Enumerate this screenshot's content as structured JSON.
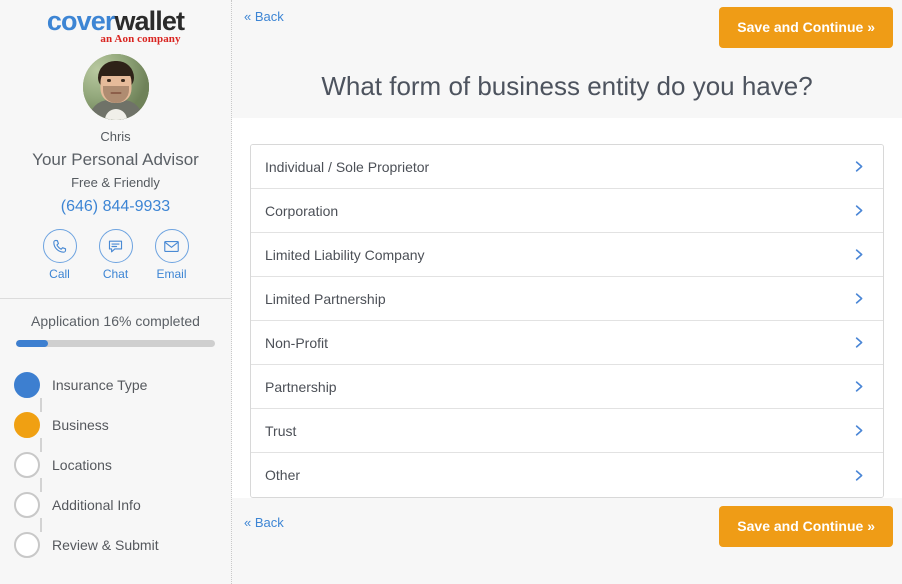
{
  "brand": {
    "logo_part1": "cover",
    "logo_part2": "wallet",
    "tagline": "an Aon company"
  },
  "sidebar": {
    "advisor": {
      "name": "Chris",
      "role": "Your Personal Advisor",
      "tagline": "Free & Friendly",
      "phone": "(646) 844-9933",
      "avatar_alt": "advisor-photo"
    },
    "contacts": [
      {
        "label": "Call",
        "icon": "phone-icon"
      },
      {
        "label": "Chat",
        "icon": "chat-icon"
      },
      {
        "label": "Email",
        "icon": "envelope-icon"
      }
    ],
    "progress": {
      "text": "Application 16% completed",
      "percent": 16,
      "fill_color": "#3d7fd0",
      "track_color": "#cfcfcf"
    },
    "steps": [
      {
        "label": "Insurance Type",
        "state": "done",
        "color": "#3d7fd0"
      },
      {
        "label": "Business",
        "state": "active",
        "color": "#f0a012"
      },
      {
        "label": "Locations",
        "state": "pending",
        "color": "#ffffff"
      },
      {
        "label": "Additional Info",
        "state": "pending",
        "color": "#ffffff"
      },
      {
        "label": "Review & Submit",
        "state": "pending",
        "color": "#ffffff"
      }
    ]
  },
  "main": {
    "top_back_label": "« Back",
    "top_save_label": "Save and Continue »",
    "title": "What form of business entity do you have?",
    "bottom_back_label": "« Back",
    "bottom_save_label": "Save and Continue »",
    "options": [
      {
        "label": "Individual / Sole Proprietor",
        "icon": "chevron-right-icon"
      },
      {
        "label": "Corporation",
        "icon": "chevron-right-icon"
      },
      {
        "label": "Limited Liability Company",
        "icon": "chevron-right-icon"
      },
      {
        "label": "Limited Partnership",
        "icon": "chevron-right-icon"
      },
      {
        "label": "Non-Profit",
        "icon": "chevron-right-icon"
      },
      {
        "label": "Partnership",
        "icon": "chevron-right-icon"
      },
      {
        "label": "Trust",
        "icon": "chevron-right-icon"
      },
      {
        "label": "Other",
        "icon": "chevron-right-icon"
      }
    ]
  },
  "colors": {
    "accent_orange": "#ef9c16",
    "accent_blue": "#3d85d4",
    "logo_red": "#d9231f",
    "page_bg": "#f7f7f7",
    "card_bg": "#ffffff"
  }
}
